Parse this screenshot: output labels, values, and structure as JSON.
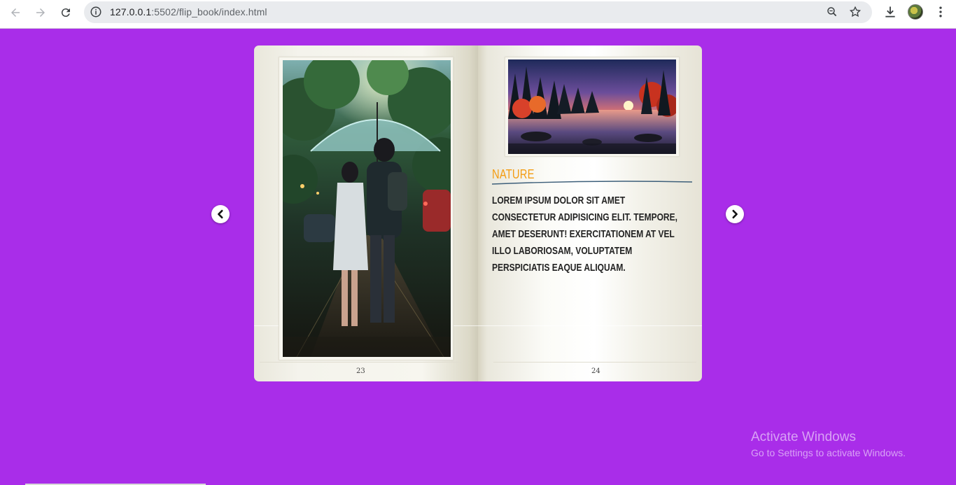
{
  "browser": {
    "url_host": "127.0.0.1",
    "url_path": ":5502/flip_book/index.html",
    "icons": [
      "back-arrow-icon",
      "forward-arrow-icon",
      "reload-icon",
      "site-info-icon",
      "zoom-icon",
      "bookmark-star-icon",
      "download-icon",
      "profile-avatar",
      "menu-dots-icon"
    ]
  },
  "book": {
    "left_page": {
      "image": "couple-under-umbrella-rain-illustration",
      "page_number": "23"
    },
    "right_page": {
      "image": "sunset-lake-forest-illustration",
      "heading": "Nature",
      "heading_color": "#f39c12",
      "body": "Lorem ipsum dolor sit amet consectetur adipisicing elit. Tempore, amet deserunt! Exercitationem at vel illo laboriosam, voluptatem perspiciatis eaque aliquam.",
      "page_number": "24"
    },
    "prev_icon": "chevron-left-icon",
    "next_icon": "chevron-right-icon"
  },
  "background_color": "#a92de9",
  "watermark": {
    "title": "Activate Windows",
    "subtitle": "Go to Settings to activate Windows."
  }
}
